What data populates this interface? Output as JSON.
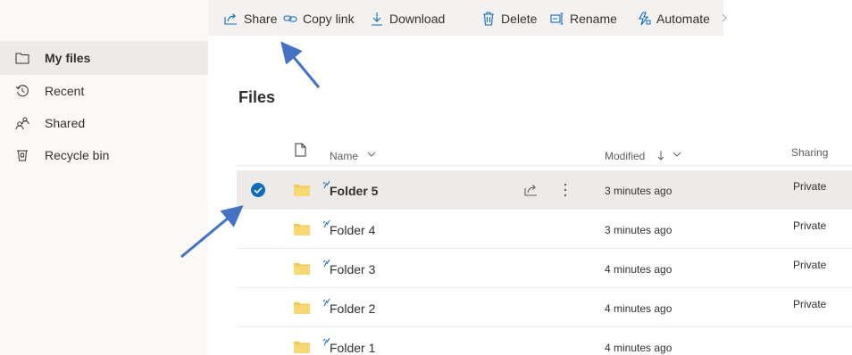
{
  "sidebar": {
    "items": [
      {
        "label": "My files",
        "icon": "folder-icon",
        "active": true
      },
      {
        "label": "Recent",
        "icon": "history-icon",
        "active": false
      },
      {
        "label": "Shared",
        "icon": "people-icon",
        "active": false
      },
      {
        "label": "Recycle bin",
        "icon": "recycle-bin-icon",
        "active": false
      }
    ]
  },
  "commandbar": {
    "share": "Share",
    "copy_link": "Copy link",
    "download": "Download",
    "delete": "Delete",
    "rename": "Rename",
    "automate": "Automate"
  },
  "page": {
    "title": "Files"
  },
  "table": {
    "columns": {
      "name": "Name",
      "modified": "Modified",
      "sharing": "Sharing"
    },
    "rows": [
      {
        "name": "Folder 5",
        "modified": "3 minutes ago",
        "sharing": "Private",
        "selected": true
      },
      {
        "name": "Folder 4",
        "modified": "3 minutes ago",
        "sharing": "Private",
        "selected": false
      },
      {
        "name": "Folder 3",
        "modified": "4 minutes ago",
        "sharing": "Private",
        "selected": false
      },
      {
        "name": "Folder 2",
        "modified": "4 minutes ago",
        "sharing": "Private",
        "selected": false
      },
      {
        "name": "Folder 1",
        "modified": "4 minutes ago",
        "sharing": "",
        "selected": false
      }
    ]
  },
  "colors": {
    "accent": "#0f6cbd",
    "folder": "#f2c94c",
    "annotation_arrow": "#4472c4",
    "selected_row": "#edebe9"
  }
}
